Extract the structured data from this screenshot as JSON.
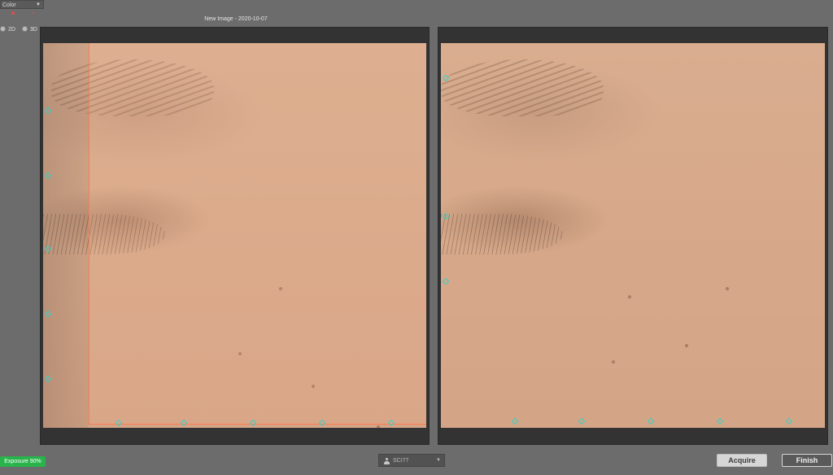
{
  "toolbar": {
    "mode_select_value": "Color",
    "dimension_options": [
      "2D",
      "3D"
    ]
  },
  "viewer": {
    "image_title": "New Image - 2020-10-07"
  },
  "status": {
    "exposure_label": "Exposure 90%"
  },
  "user_select": {
    "value": "SCI77"
  },
  "buttons": {
    "acquire_label": "Acquire",
    "finish_label": "Finish"
  },
  "colors": {
    "accent_green": "#28b34b",
    "overlay_outline": "#ff7b4f",
    "marker_cyan": "#33d1c9"
  }
}
